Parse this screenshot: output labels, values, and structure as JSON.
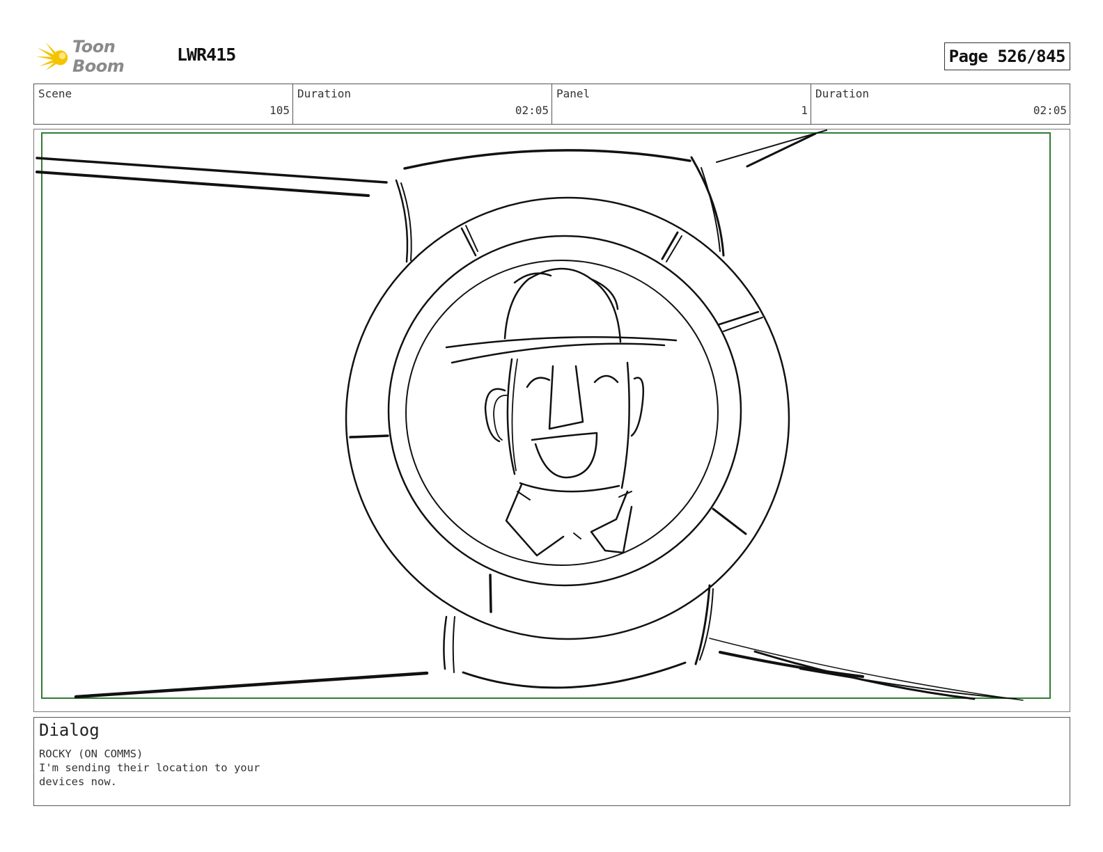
{
  "header": {
    "logo_text": "Toon Boom",
    "project_code": "LWR415",
    "page_label": "Page 526/845"
  },
  "info": {
    "scene_label": "Scene",
    "scene_value": "105",
    "scene_duration_label": "Duration",
    "scene_duration_value": "02:05",
    "panel_label": "Panel",
    "panel_value": "1",
    "panel_duration_label": "Duration",
    "panel_duration_value": "02:05"
  },
  "dialog": {
    "title": "Dialog",
    "text": "ROCKY (ON COMMS)\nI'm sending their location to your\ndevices now."
  },
  "colors": {
    "safe_area_border": "#2e7d32",
    "logo_star": "#f5c400"
  }
}
